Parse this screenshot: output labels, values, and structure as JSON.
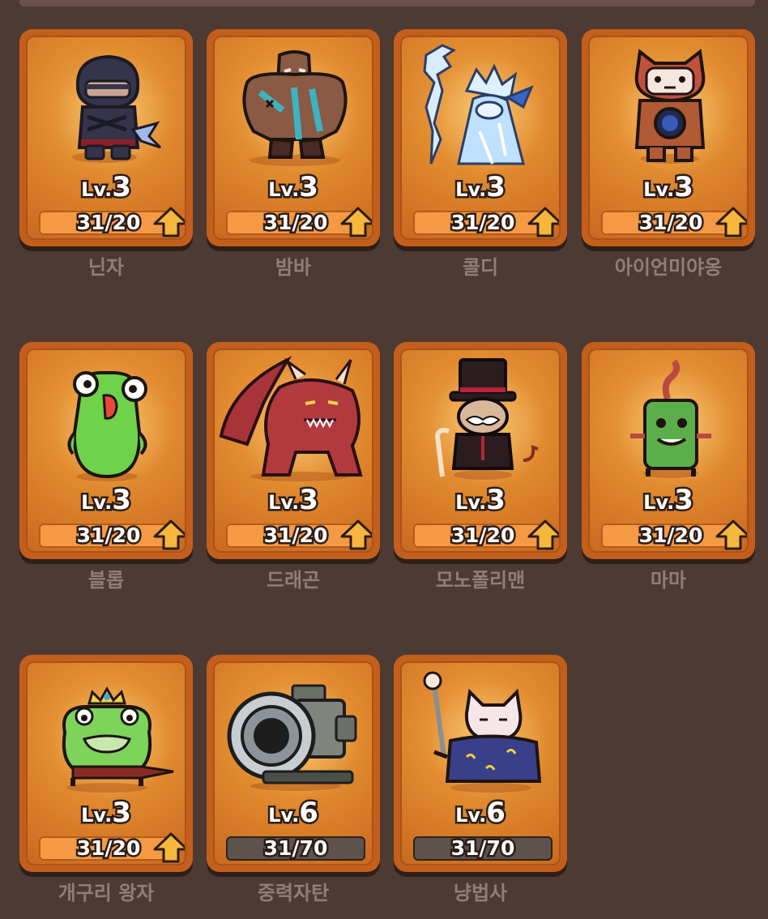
{
  "level_prefix": "Lv.",
  "cards": [
    {
      "name": "닌자",
      "level": "3",
      "progress": "31/20",
      "upgradable": true,
      "icon": "ninja-icon"
    },
    {
      "name": "밤바",
      "level": "3",
      "progress": "31/20",
      "upgradable": true,
      "icon": "golem-icon"
    },
    {
      "name": "콜디",
      "level": "3",
      "progress": "31/20",
      "upgradable": true,
      "icon": "ice-mage-icon"
    },
    {
      "name": "아이언미야옹",
      "level": "3",
      "progress": "31/20",
      "upgradable": true,
      "icon": "iron-cat-icon"
    },
    {
      "name": "블롭",
      "level": "3",
      "progress": "31/20",
      "upgradable": true,
      "icon": "blob-icon"
    },
    {
      "name": "드래곤",
      "level": "3",
      "progress": "31/20",
      "upgradable": true,
      "icon": "dragon-icon"
    },
    {
      "name": "모노폴리맨",
      "level": "3",
      "progress": "31/20",
      "upgradable": true,
      "icon": "monopoly-man-icon"
    },
    {
      "name": "마마",
      "level": "3",
      "progress": "31/20",
      "upgradable": true,
      "icon": "cactus-icon"
    },
    {
      "name": "개구리 왕자",
      "level": "3",
      "progress": "31/20",
      "upgradable": true,
      "icon": "frog-prince-icon"
    },
    {
      "name": "중력자탄",
      "level": "6",
      "progress": "31/70",
      "upgradable": false,
      "icon": "cannon-icon"
    },
    {
      "name": "냥법사",
      "level": "6",
      "progress": "31/70",
      "upgradable": false,
      "icon": "cat-wizard-icon"
    }
  ],
  "colors": {
    "background": "#4d3a33",
    "card_frame": "#c45e1b",
    "progress_fill": "#f59a44",
    "progress_track_locked": "#5d534c",
    "upgrade_arrow": "#f6b73c",
    "name_text": "#8e7f78"
  }
}
